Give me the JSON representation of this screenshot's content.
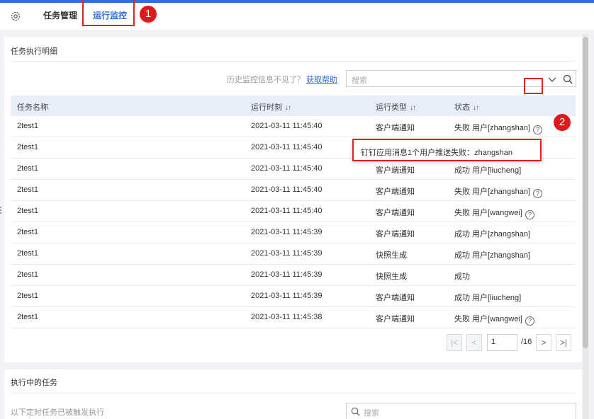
{
  "tabs": [
    {
      "label": "任务管理"
    },
    {
      "label": "运行监控"
    }
  ],
  "annotations": {
    "badge1": "1",
    "badge2": "2"
  },
  "colors": {
    "accent": "#2b6fe0",
    "highlight": "#e32020"
  },
  "card1": {
    "title": "任务执行明细",
    "hint": "历史监控信息不见了？",
    "help_link": "获取帮助",
    "search_placeholder": "搜索"
  },
  "table": {
    "headers": [
      "任务名称",
      "运行时刻",
      "运行类型",
      "状态"
    ],
    "sort_icon": "↓↑",
    "rows": [
      {
        "name": "2test1",
        "time": "2021-03-11 11:45:40",
        "type": "客户端通知",
        "status": "失败 用户[zhangshan]",
        "has_help": true
      },
      {
        "name": "2test1",
        "time": "2021-03-11 11:45:40",
        "type": "",
        "status": "",
        "has_help": false
      },
      {
        "name": "2test1",
        "time": "2021-03-11 11:45:40",
        "type": "客户端通知",
        "status": "成功 用户[liucheng]",
        "has_help": false
      },
      {
        "name": "2test1",
        "time": "2021-03-11 11:45:40",
        "type": "客户端通知",
        "status": "失败 用户[zhangshan]",
        "has_help": true
      },
      {
        "name": "2test1",
        "time": "2021-03-11 11:45:40",
        "type": "客户端通知",
        "status": "失败 用户[wangwei]",
        "has_help": true
      },
      {
        "name": "2test1",
        "time": "2021-03-11 11:45:39",
        "type": "客户端通知",
        "status": "成功 用户[zhangshan]",
        "has_help": false
      },
      {
        "name": "2test1",
        "time": "2021-03-11 11:45:39",
        "type": "快照生成",
        "status": "成功 用户[zhangshan]",
        "has_help": false
      },
      {
        "name": "2test1",
        "time": "2021-03-11 11:45:39",
        "type": "快照生成",
        "status": "成功",
        "has_help": false
      },
      {
        "name": "2test1",
        "time": "2021-03-11 11:45:39",
        "type": "客户端通知",
        "status": "成功 用户[liucheng]",
        "has_help": false
      },
      {
        "name": "2test1",
        "time": "2021-03-11 11:45:38",
        "type": "客户端通知",
        "status": "失败 用户[wangwei]",
        "has_help": true
      }
    ]
  },
  "tooltip": {
    "text": "钉钉应用消息1个用户推送失败：zhangshan"
  },
  "pagination": {
    "first": "|<",
    "prev": "<",
    "current_page": "1",
    "total": "/16",
    "next": ">",
    "last": ">|"
  },
  "card2": {
    "title": "执行中的任务",
    "note": "以下定时任务已被触发执行",
    "search_placeholder": "搜索"
  }
}
